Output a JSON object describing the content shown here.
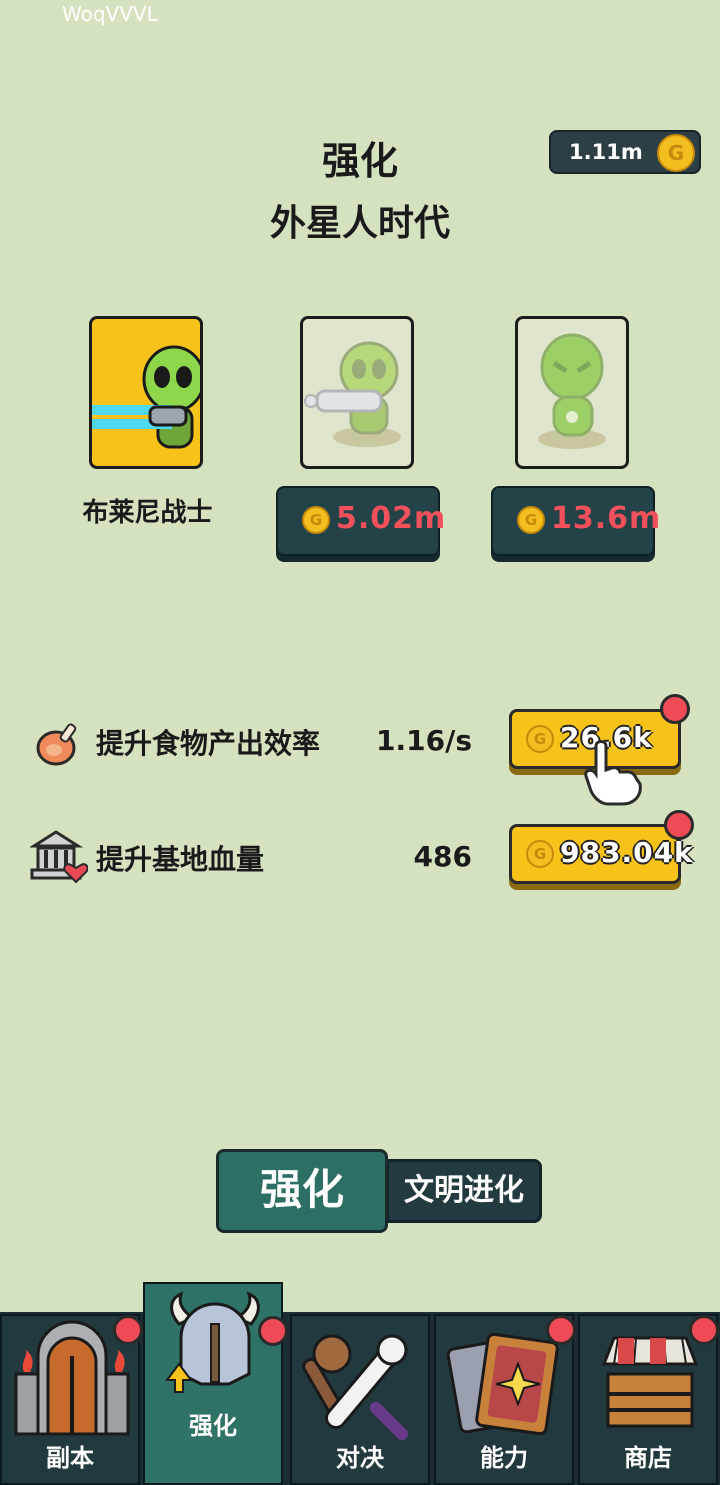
{
  "watermark": "WoqVVVL",
  "header": {
    "title": "强化",
    "subtitle": "外星人时代"
  },
  "currency": {
    "amount": "1.11m",
    "coin_symbol": "G"
  },
  "units": [
    {
      "name": "布莱尼战士",
      "state": "selected"
    },
    {
      "state": "locked",
      "price": "5.02m"
    },
    {
      "state": "locked",
      "price": "13.6m"
    }
  ],
  "upgrades": [
    {
      "label": "提升食物产出效率",
      "value": "1.16/s",
      "cost": "26.6k",
      "icon": "meat-icon"
    },
    {
      "label": "提升基地血量",
      "value": "486",
      "cost": "983.04k",
      "icon": "base-heart-icon"
    }
  ],
  "tabs": {
    "main": "强化",
    "second": "文明进化"
  },
  "nav": [
    {
      "label": "副本",
      "icon": "gate-icon",
      "badge": true
    },
    {
      "label": "强化",
      "icon": "helmet-icon",
      "badge": true,
      "active": true
    },
    {
      "label": "对决",
      "icon": "weapons-icon",
      "badge": false
    },
    {
      "label": "能力",
      "icon": "cards-icon",
      "badge": true
    },
    {
      "label": "商店",
      "icon": "shop-icon",
      "badge": true
    }
  ],
  "colors": {
    "background": "#d5e2c0",
    "accent": "#f7c21a",
    "dark": "#234348",
    "price_text": "#f2505b",
    "badge": "#ee4b57"
  }
}
